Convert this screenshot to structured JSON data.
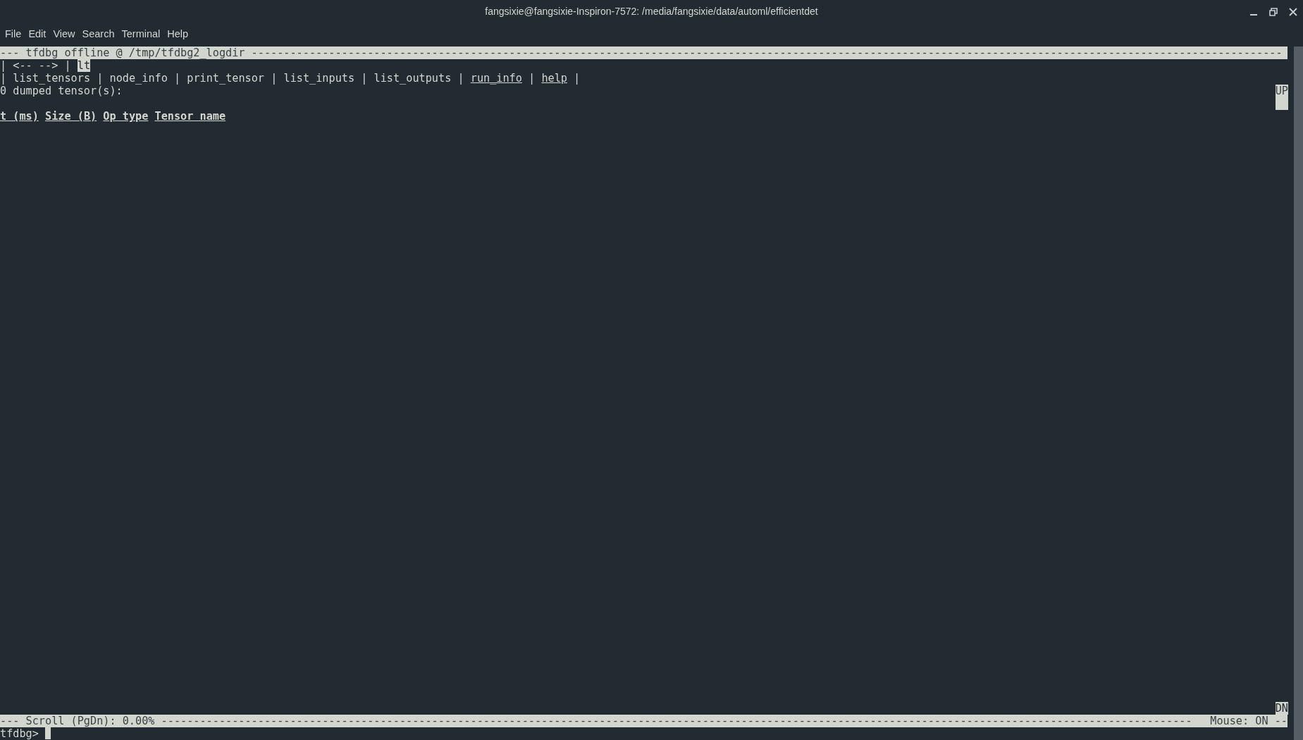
{
  "window": {
    "title": "fangsixie@fangsixie-Inspiron-7572: /media/fangsixie/data/automl/efficientdet"
  },
  "menu_bar": [
    "File",
    "Edit",
    "View",
    "Search",
    "Terminal",
    "Help"
  ],
  "terminal": {
    "header": "--- tfdbg offline @ /tmp/tfdbg2_logdir ----------------------------------------------------------------------------------------------------------------------------------------------------------------",
    "nav": [
      {
        "text": "| <-- --> | ",
        "highlighted": false
      },
      {
        "text": "lt",
        "highlighted": true
      }
    ],
    "commands": [
      {
        "kind": "separator",
        "text": "|"
      },
      {
        "kind": "command",
        "text": "list_tensors",
        "underlined": false
      },
      {
        "kind": "separator",
        "text": "|"
      },
      {
        "kind": "command",
        "text": "node_info",
        "underlined": false
      },
      {
        "kind": "separator",
        "text": "|"
      },
      {
        "kind": "command",
        "text": "print_tensor",
        "underlined": false
      },
      {
        "kind": "separator",
        "text": "|"
      },
      {
        "kind": "command",
        "text": "list_inputs",
        "underlined": false
      },
      {
        "kind": "separator",
        "text": "|"
      },
      {
        "kind": "command",
        "text": "list_outputs",
        "underlined": false
      },
      {
        "kind": "separator",
        "text": "|"
      },
      {
        "kind": "command",
        "text": "run_info",
        "underlined": true
      },
      {
        "kind": "separator",
        "text": "|"
      },
      {
        "kind": "command",
        "text": "help",
        "underlined": true
      },
      {
        "kind": "separator",
        "text": "|"
      }
    ],
    "status": "0 dumped tensor(s):",
    "columns": [
      "t (ms)",
      "Size (B)",
      "Op type",
      "Tensor name"
    ],
    "scroll_up": "UP",
    "scroll_down": "DN",
    "footer_left": "--- Scroll (PgDn): 0.00% ----------------------------------------------------------------------------------------------------------------------------------------------------------------",
    "footer_right": "Mouse: ON --",
    "prompt": "tfdbg>"
  }
}
